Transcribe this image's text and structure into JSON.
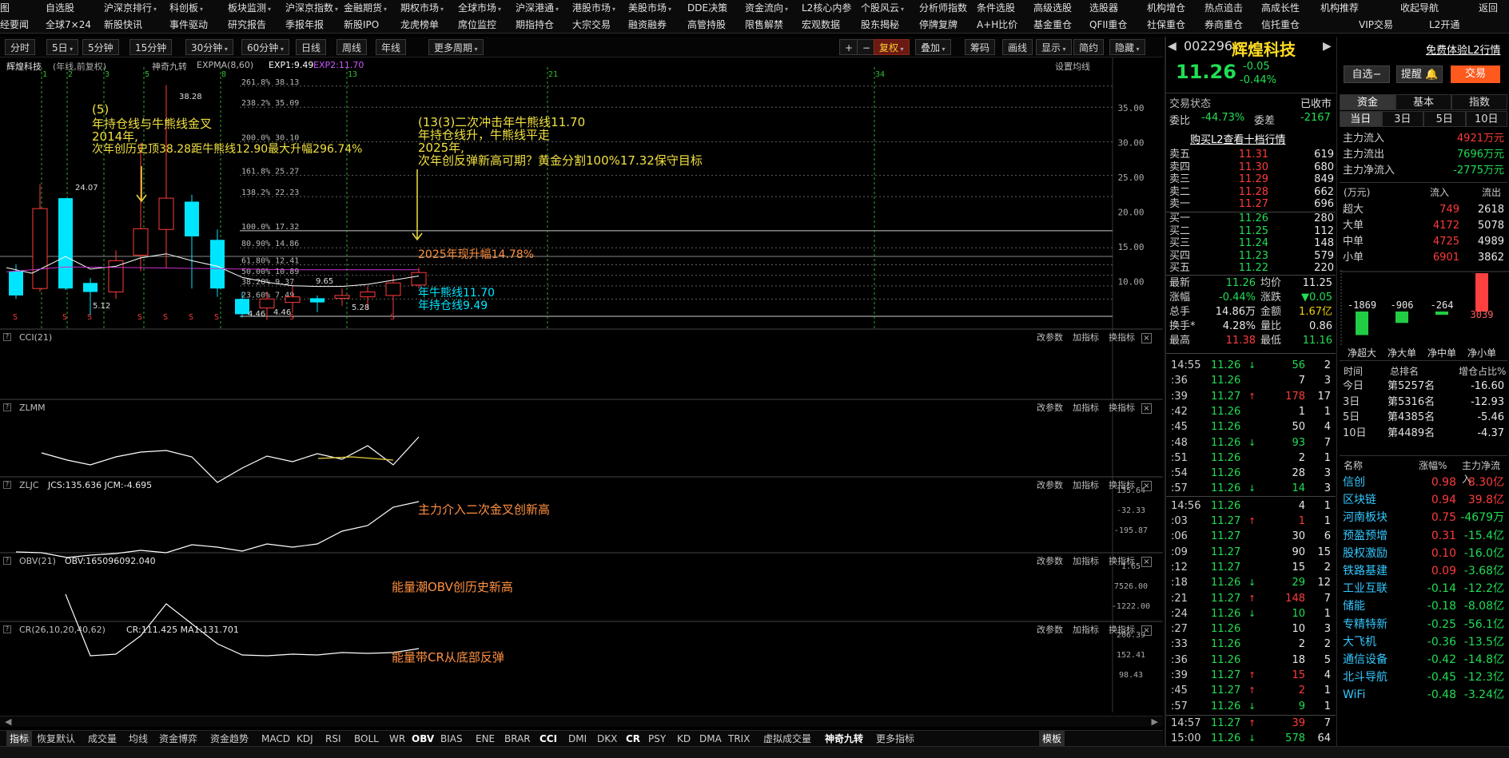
{
  "menu": {
    "row1": [
      "图",
      "自选股",
      "沪深京排行",
      "科创板",
      "板块监测",
      "沪深京指数",
      "金融期货",
      "期权市场",
      "全球市场",
      "沪深港通",
      "港股市场",
      "美股市场",
      "DDE决策",
      "资金流向",
      "L2核心内参",
      "个股风云",
      "分析师指数",
      "条件选股",
      "高级选股",
      "选股器",
      "机构增仓",
      "热点追击",
      "高成长性",
      "机构推荐",
      "收起导航",
      "返回"
    ],
    "row2": [
      "经要闻",
      "全球7×24",
      "新股快讯",
      "事件驱动",
      "研究报告",
      "季报年报",
      "新股IPO",
      "龙虎榜单",
      "席位监控",
      "期指持仓",
      "大宗交易",
      "融资融券",
      "高管持股",
      "限售解禁",
      "宏观数据",
      "股东揭秘",
      "停牌复牌",
      "A+H比价",
      "基金重仓",
      "QFII重仓",
      "社保重仓",
      "券商重仓",
      "信托重仓",
      "VIP交易",
      "L2开通"
    ]
  },
  "toolbar": {
    "left": [
      "分时",
      "5日",
      "5分钟",
      "15分钟",
      "30分钟",
      "60分钟",
      "日线",
      "周线",
      "年线",
      "更多周期"
    ],
    "right": [
      "+",
      "−",
      "复权",
      "叠加",
      "筹码",
      "画线",
      "显示",
      "简约",
      "隐藏"
    ],
    "active": "复权"
  },
  "main_chart": {
    "header": [
      "辉煌科技",
      "(年线,前复权)",
      "神奇九转",
      "EXPMA(8,60)",
      "EXP1:9.49",
      "EXP2:11.70"
    ],
    "settings": "设置均线",
    "y_ticks": [
      "35.00",
      "30.00",
      "25.00",
      "20.00",
      "15.00",
      "10.00"
    ],
    "fib": [
      "261.8% 38.13",
      "238.2% 35.09",
      "200.0% 30.10",
      "161.8% 25.27",
      "138.2% 22.23",
      "100.0% 17.32",
      "80.90% 14.86",
      "61.80% 12.41",
      "50.00% 10.89",
      "38.20% 9.37",
      "23.60% 7.49"
    ],
    "counts": [
      "1",
      "2",
      "3",
      "5",
      "8",
      "13",
      "21",
      "34"
    ],
    "notes": {
      "a1": "(5)",
      "a2": "年持仓线与牛熊线金叉",
      "a3": "2014年,",
      "a4": "次年创历史顶38.28距牛熊线12.90最大升幅296.74%",
      "b1": "(13(3)二次冲击年牛熊线11.70",
      "b2": "年持仓线升，牛熊线平走",
      "b3": "2025年,",
      "b4": "次年创反弹新高可期？黄金分割100%17.32保守目标",
      "c1": "2025年现升幅14.78%",
      "d1": "年牛熊线11.70",
      "d2": "年持仓线9.49"
    },
    "price_labels": [
      "38.28",
      "24.07",
      "5.12",
      "5.28",
      "4.46",
      "4.46",
      "9.65"
    ]
  },
  "panels": [
    {
      "label": "CCI(21)",
      "extra": ""
    },
    {
      "label": "ZLMM",
      "extra": ""
    },
    {
      "label": "ZLJC",
      "extra": "JCS:135.636  JCM:-4.695",
      "ticks": [
        "135.64",
        "-32.33",
        "-195.87"
      ],
      "note": "主力介入二次金叉创新高"
    },
    {
      "label": "OBV(21)",
      "extra": "OBV:165096092.040",
      "ticks": [
        "1.65",
        "7526.00",
        "-1222.00"
      ],
      "note": "能量潮OBV创历史新高"
    },
    {
      "label": "CR(26,10,20,40,62)",
      "extra": "CR:111.425  MA1:131.701",
      "ticks": [
        "206.39",
        "152.41",
        "98.43"
      ],
      "note": "能量带CR从底部反弹"
    }
  ],
  "panel_actions": [
    "改参数",
    "加指标",
    "换指标"
  ],
  "bottom_tabs": [
    "指标",
    "恢复默认",
    "成交量",
    "均线",
    "资金博弈",
    "资金趋势",
    "MACD",
    "KDJ",
    "RSI",
    "BOLL",
    "WR",
    "OBV",
    "BIAS",
    "ENE",
    "BRAR",
    "CCI",
    "DMI",
    "DKX",
    "CR",
    "PSY",
    "KD",
    "DMA",
    "TRIX",
    "虚拟成交量",
    "神奇九转",
    "更多指标",
    "模板"
  ],
  "quote": {
    "code": "002296",
    "name": "辉煌科技",
    "price": "11.26",
    "change": "-0.05",
    "pct": "-0.44%",
    "trial": "免费体验L2行情",
    "btn_watch": "自选−",
    "btn_alert": "提醒",
    "btn_trade": "交易",
    "state_label": "交易状态",
    "state": "已收市",
    "weibi_label": "委比",
    "weibi": "-44.73%",
    "weicha_label": "委差",
    "weicha": "-2167",
    "l2_link": "购买L2查看十档行情",
    "asks": [
      [
        "卖五",
        "11.31",
        "619"
      ],
      [
        "卖四",
        "11.30",
        "680"
      ],
      [
        "卖三",
        "11.29",
        "849"
      ],
      [
        "卖二",
        "11.28",
        "662"
      ],
      [
        "卖一",
        "11.27",
        "696"
      ]
    ],
    "bids": [
      [
        "买一",
        "11.26",
        "280"
      ],
      [
        "买二",
        "11.25",
        "112"
      ],
      [
        "买三",
        "11.24",
        "148"
      ],
      [
        "买四",
        "11.23",
        "579"
      ],
      [
        "买五",
        "11.22",
        "220"
      ]
    ],
    "stats": [
      [
        "最新",
        "11.26",
        "均价",
        "11.25"
      ],
      [
        "涨幅",
        "-0.44%",
        "涨跌",
        "▼0.05"
      ],
      [
        "总手",
        "14.86万",
        "金额",
        "1.67亿"
      ],
      [
        "换手*",
        "4.28%",
        "量比",
        "0.86"
      ],
      [
        "最高",
        "11.38",
        "最低",
        "11.16"
      ]
    ],
    "ticks": [
      [
        "14:55",
        "11.26",
        "↓",
        "56",
        "2"
      ],
      [
        ":36",
        "11.26",
        "",
        "7",
        "3"
      ],
      [
        ":39",
        "11.27",
        "↑",
        "178",
        "17"
      ],
      [
        ":42",
        "11.26",
        "",
        "1",
        "1"
      ],
      [
        ":45",
        "11.26",
        "",
        "50",
        "4"
      ],
      [
        ":48",
        "11.26",
        "↓",
        "93",
        "7"
      ],
      [
        ":51",
        "11.26",
        "",
        "2",
        "1"
      ],
      [
        ":54",
        "11.26",
        "",
        "28",
        "3"
      ],
      [
        ":57",
        "11.26",
        "↓",
        "14",
        "3"
      ],
      [
        "14:56",
        "11.26",
        "",
        "4",
        "1"
      ],
      [
        ":03",
        "11.27",
        "↑",
        "1",
        "1"
      ],
      [
        ":06",
        "11.27",
        "",
        "30",
        "6"
      ],
      [
        ":09",
        "11.27",
        "",
        "90",
        "15"
      ],
      [
        ":12",
        "11.27",
        "",
        "15",
        "2"
      ],
      [
        ":18",
        "11.26",
        "↓",
        "29",
        "12"
      ],
      [
        ":21",
        "11.27",
        "↑",
        "148",
        "7"
      ],
      [
        ":24",
        "11.26",
        "↓",
        "10",
        "1"
      ],
      [
        ":27",
        "11.26",
        "",
        "10",
        "3"
      ],
      [
        ":33",
        "11.26",
        "",
        "2",
        "2"
      ],
      [
        ":36",
        "11.26",
        "",
        "18",
        "5"
      ],
      [
        ":39",
        "11.27",
        "↑",
        "15",
        "4"
      ],
      [
        ":45",
        "11.27",
        "↑",
        "2",
        "1"
      ],
      [
        ":57",
        "11.26",
        "↓",
        "9",
        "1"
      ],
      [
        "14:57",
        "11.27",
        "↑",
        "39",
        "7"
      ],
      [
        "15:00",
        "11.26",
        "↓",
        "578",
        "64"
      ]
    ]
  },
  "fund": {
    "tabs": [
      "资金",
      "基本",
      "指数"
    ],
    "periods": [
      "当日",
      "3日",
      "5日",
      "10日"
    ],
    "flows": [
      [
        "主力流入",
        "4921万元"
      ],
      [
        "主力流出",
        "7696万元"
      ],
      [
        "主力净流入",
        "-2775万元"
      ]
    ],
    "unit": "(万元)",
    "in_label": "流入",
    "out_label": "流出",
    "caps": [
      [
        "超大",
        "749",
        "2618"
      ],
      [
        "大单",
        "4172",
        "5078"
      ],
      [
        "中单",
        "4725",
        "4989"
      ],
      [
        "小单",
        "6901",
        "3862"
      ]
    ],
    "bars": [
      [
        "净超大",
        "-1869"
      ],
      [
        "净大单",
        "-906"
      ],
      [
        "净中单",
        "-264"
      ],
      [
        "净小单",
        "3039"
      ]
    ],
    "rank_head": [
      "时间",
      "总排名",
      "增仓占比%"
    ],
    "ranks": [
      [
        "今日",
        "第5257名",
        "-16.60"
      ],
      [
        "3日",
        "第5316名",
        "-12.93"
      ],
      [
        "5日",
        "第4385名",
        "-5.46"
      ],
      [
        "10日",
        "第4489名",
        "-4.37"
      ]
    ],
    "sector_head": [
      "名称",
      "涨幅%",
      "主力净流入"
    ],
    "sectors": [
      [
        "信创",
        "0.98",
        "8.30亿"
      ],
      [
        "区块链",
        "0.94",
        "39.8亿"
      ],
      [
        "河南板块",
        "0.75",
        "-4679万"
      ],
      [
        "预盈预增",
        "0.31",
        "-15.4亿"
      ],
      [
        "股权激励",
        "0.10",
        "-16.0亿"
      ],
      [
        "铁路基建",
        "0.09",
        "-3.68亿"
      ],
      [
        "工业互联",
        "-0.14",
        "-12.2亿"
      ],
      [
        "储能",
        "-0.18",
        "-8.08亿"
      ],
      [
        "专精特新",
        "-0.25",
        "-56.1亿"
      ],
      [
        "大飞机",
        "-0.36",
        "-13.5亿"
      ],
      [
        "通信设备",
        "-0.42",
        "-14.8亿"
      ],
      [
        "北斗导航",
        "-0.45",
        "-12.3亿"
      ],
      [
        "WiFi",
        "-0.48",
        "-3.24亿"
      ]
    ]
  },
  "colors": {
    "up": "#ff3b3b",
    "down": "#22dd55",
    "bull": "#00e5ff",
    "note": "#f0e040",
    "orange": "#ff9040"
  }
}
